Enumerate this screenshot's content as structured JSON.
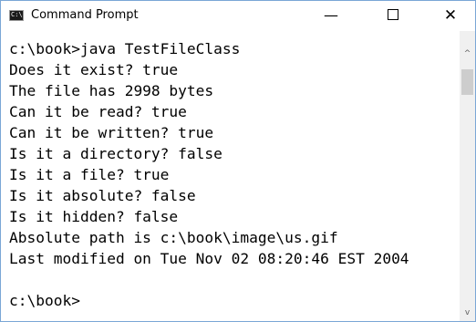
{
  "window": {
    "title": "Command Prompt",
    "icon_label": "C:\\",
    "controls": {
      "minimize": "—",
      "close": "✕"
    }
  },
  "console": {
    "lines": [
      "c:\\book>java TestFileClass",
      "Does it exist? true",
      "The file has 2998 bytes",
      "Can it be read? true",
      "Can it be written? true",
      "Is it a directory? false",
      "Is it a file? true",
      "Is it absolute? false",
      "Is it hidden? false",
      "Absolute path is c:\\book\\image\\us.gif",
      "Last modified on Tue Nov 02 08:20:46 EST 2004",
      "",
      "c:\\book>"
    ]
  },
  "scrollbar": {
    "up_arrow": "^",
    "down_arrow": "v"
  },
  "icons": [
    "cmd-app-icon",
    "minimize-icon",
    "maximize-icon",
    "close-icon",
    "scroll-up-icon",
    "scroll-down-icon"
  ]
}
